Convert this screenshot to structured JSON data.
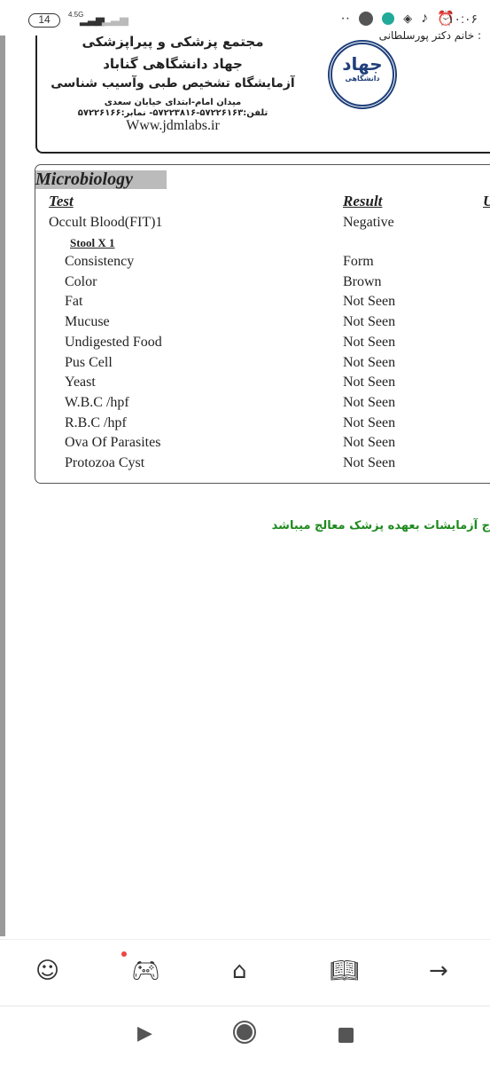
{
  "status_bar": {
    "battery": "14",
    "network": "4.5G",
    "time": "۱۰:۰۶"
  },
  "header": {
    "line1": "مجتمع پزشکی و پیراپزشکی",
    "line2": "جهاد دانشگاهی گناباد",
    "line3": "آزمایشگاه تشخیص طبی وآسیب شناسی",
    "address": "میدان امام-ابتدای خیابان سعدی",
    "phones": "تلفن:۵۷۲۲۶۱۶۳-۵۷۲۲۳۸۱۶- نمابر:۵۷۲۲۶۱۶۶",
    "website": "Www.jdmlabs.ir",
    "logo_text": "جهاد",
    "logo_sub": "دانشگاهی",
    "doctor": ": خانم دکتر پورسلطانی"
  },
  "report": {
    "section": "Microbiology",
    "columns": {
      "test": "Test",
      "result": "Result",
      "unit": "U"
    },
    "occult": {
      "test": "Occult Blood(FIT)1",
      "result": "Negative"
    },
    "subheading": "Stool X 1",
    "rows": [
      {
        "test": "Consistency",
        "result": "Form"
      },
      {
        "test": "Color",
        "result": "Brown"
      },
      {
        "test": "Fat",
        "result": "Not Seen"
      },
      {
        "test": "Mucuse",
        "result": "Not Seen"
      },
      {
        "test": "Undigested Food",
        "result": "Not Seen"
      },
      {
        "test": "Pus Cell",
        "result": "Not Seen"
      },
      {
        "test": "Yeast",
        "result": "Not Seen"
      },
      {
        "test": "W.B.C /hpf",
        "result": "Not Seen"
      },
      {
        "test": "R.B.C /hpf",
        "result": "Not Seen"
      },
      {
        "test": "Ova Of Parasites",
        "result": "Not Seen"
      },
      {
        "test": "Protozoa Cyst",
        "result": "Not Seen"
      }
    ]
  },
  "footer_note": "ج آزمایشات بعهده پزشک معالج میباشد",
  "colors": {
    "footer_note": "#1e8a1e",
    "logo": "#1f3f7a",
    "notification": "#e44444"
  },
  "bottom_nav": [
    "profile-icon",
    "gamepad-icon",
    "home-icon",
    "book-icon",
    "arrow-right-icon"
  ],
  "system_nav": [
    "back",
    "home",
    "recents"
  ]
}
